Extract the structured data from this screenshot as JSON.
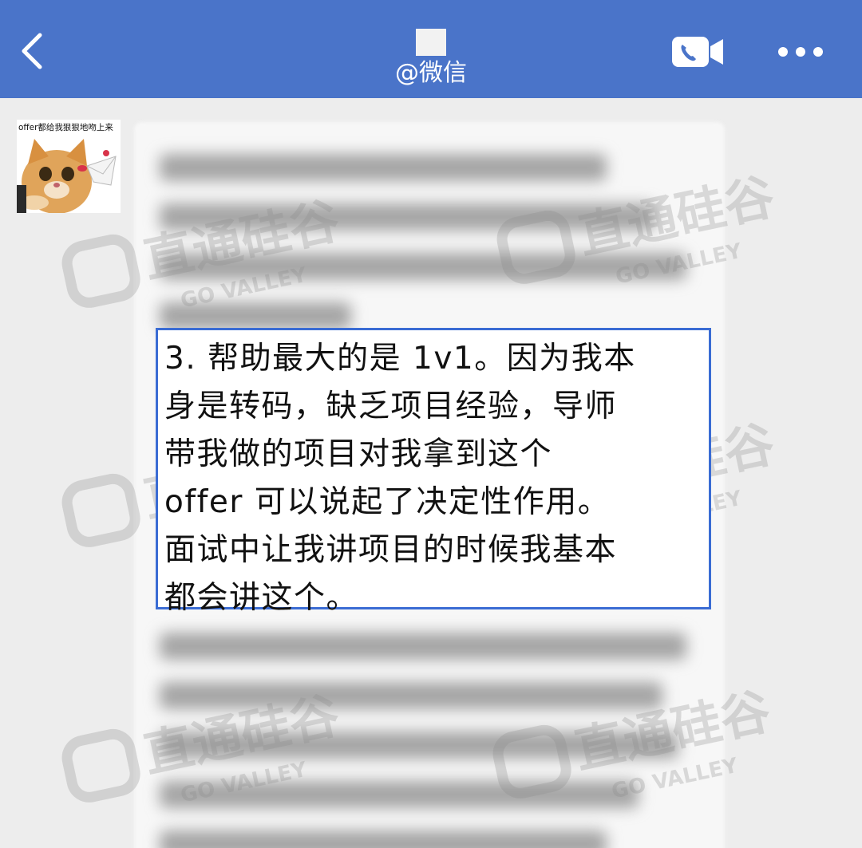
{
  "header": {
    "subtitle": "@微信",
    "back_icon": "chevron-left-icon",
    "video_icon": "video-call-icon",
    "more_icon": "more-dots-icon",
    "bg_color": "#4a74c9"
  },
  "sticker": {
    "caption": "offer都给我狠狠地吻上来"
  },
  "message": {
    "lines": [
      "3. 帮助最大的是 1v1。因为我本",
      "身是转码，缺乏项目经验，导师",
      "带我做的项目对我拿到这个",
      "offer 可以说起了决定性作用。",
      "面试中让我讲项目的时候我基本",
      "都会讲这个。"
    ],
    "highlight_color": "#3a6cd4"
  },
  "watermark": {
    "brand": "直通硅谷",
    "sub": "GO VALLEY"
  }
}
